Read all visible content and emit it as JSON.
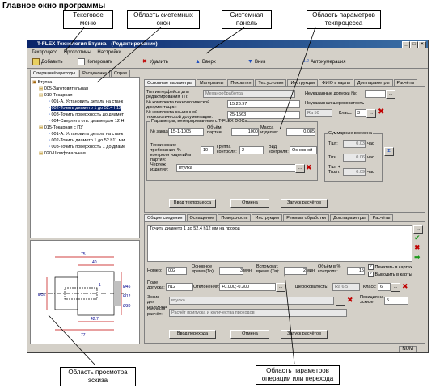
{
  "heading": "Главное окно программы",
  "callouts": {
    "text_menu": "Текстовое меню",
    "system_windows": "Область системных окон",
    "system_panel": "Системная панель",
    "process_params": "Область параметров техпроцесса",
    "sketch_view": "Область просмотра эскиза",
    "operation_params": "Область параметров операции или перехода"
  },
  "window": {
    "title": "T-FLEX Технология Втулка",
    "title_suffix": "(Редактирование)",
    "menu": [
      "Техпроцесс",
      "Протоптины",
      "Настройки"
    ],
    "toolbar": {
      "add": "Добавить",
      "copy": "Копировать",
      "delete": "Удалить",
      "up": "Вверх",
      "down": "Вниз",
      "auto": "Автонумерация"
    },
    "status": "NUM"
  },
  "left_tabs": [
    "Операции/переходы",
    "Расценочка",
    "Справ"
  ],
  "tree": {
    "root": "Втулка",
    "items": [
      {
        "code": "005-Заготовительная",
        "level": 1
      },
      {
        "code": "010-Токарная",
        "level": 1
      },
      {
        "code": "001-А. Установить деталь на станк",
        "level": 2
      },
      {
        "code": "002-Точить диаметр 1 до 52.4 h12",
        "level": 2
      },
      {
        "code": "003-Точить поверхность до диамет",
        "level": 2
      },
      {
        "code": "004-Сверлить отв. диаметром 12 Н",
        "level": 2
      },
      {
        "code": "015-Токарная с ПУ",
        "level": 1
      },
      {
        "code": "001-А. Установить деталь на станк",
        "level": 2
      },
      {
        "code": "002-Точить диаметр 1 до 52.h11 мм",
        "level": 2
      },
      {
        "code": "003-Точить поверхность 1 до диаме",
        "level": 2
      },
      {
        "code": "020-Шлифовальная",
        "level": 1
      }
    ]
  },
  "sketch": {
    "dims": [
      "75",
      "40",
      "42.7",
      "77",
      "Ø52",
      "Ø45",
      "Ø12",
      "Ø30",
      "1"
    ]
  },
  "process_tabs": [
    "Основные параметры",
    "Материалы",
    "Покрытия",
    "Тех.условия",
    "Инструкции",
    "ФИЮ в карты",
    "Доп.параметры",
    "Расчёты"
  ],
  "process": {
    "template_label": "Тип интерфейса для редактирования ТП:",
    "template_value": "Механообработка",
    "doc_number_label": "№ комплекта технологической документации:",
    "doc_number": "15:23:97",
    "ref_doc_label": "№ комплекта ссылочной технологической документации:",
    "ref_doc": "25-1563",
    "tolerance_label": "Неуказанные допуски №:",
    "roughness_label": "Неуказанная шероховатость",
    "roughness": "Ra 50",
    "class_label": "Класс:",
    "class_value": "3",
    "integrated_label": "Параметры, интегрированные с T-FLEX DOCs",
    "order_label": "№ заказа:",
    "order": "15-1-1005",
    "batch_label": "Объём партии:",
    "batch": "1000",
    "mass_label": "Масса изделия:",
    "mass": "0.085",
    "tech_req_label": "Технические требования: % контроля изделий в партии:",
    "tech_req": "10",
    "group_label": "Группа контроля:",
    "group": "2",
    "control_label": "Вид контроля:",
    "control": "Основной",
    "drawing_label": "Чертеж изделия:",
    "drawing": "втулка",
    "times_label": "Суммарные времена",
    "t_pc_label": "Тшт:",
    "t_pc": "0.03",
    "t_prep_label": "Тпз:",
    "t_prep": "0.06",
    "t_total_label": "Тшт + Тпз/n:",
    "t_total": "0.09",
    "unit": "час",
    "buttons": [
      "Ввод техпроцесса",
      "Отмена",
      "Запуск расчётов"
    ]
  },
  "op_tabs": [
    "Общие сведения",
    "Оснащение",
    "Поверхности",
    "Инструкции",
    "Режимы обработки",
    "Доп.параметры",
    "Расчёты"
  ],
  "operation": {
    "text": "Точить диаметр 1 до 52.4 h12 мм на проход",
    "num_label": "Номер:",
    "num": "002",
    "main_time_label": "Основное время (То):",
    "main_time": "3",
    "aux_time_label": "Вспомогат. время (Тв):",
    "aux_time": "2",
    "time_unit": "мин",
    "volume_label": "Объём в % контроля:",
    "volume": "15",
    "print_label": "Печатать в картах",
    "output_label": "Выводить в карты",
    "field_label": "Поле допуска:",
    "field": "h12",
    "dev_label": "Отклонения:",
    "dev": "+0.000;-0.300",
    "rough_label": "Шероховатость:",
    "rough": "Ra 6.5",
    "class_label": "Класс:",
    "class_value": "6",
    "sketch_label": "Эскиз для перехода:",
    "sketch": "втулка",
    "pos_label": "Позиция на эскизе:",
    "pos": "5",
    "base_label": "Базовый расчёт:",
    "base": "Расчёт припуска и количества проходов",
    "buttons": [
      "Ввод перехода",
      "Отмена",
      "Запуск расчётов"
    ]
  }
}
